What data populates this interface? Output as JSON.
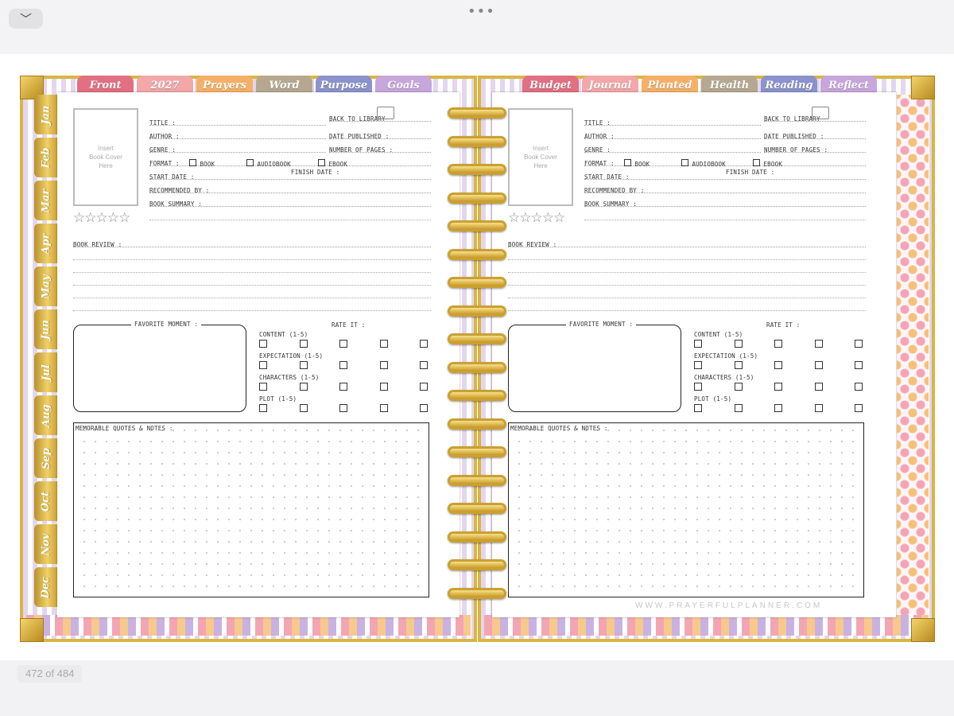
{
  "viewer": {
    "collapse_icon": "chevron-down-icon",
    "more_icon": "ellipsis-icon",
    "more_label": "•••",
    "collapse_label": "﹀",
    "page_indicator": "472 of 484"
  },
  "colors": {
    "tab_front": "#e26f82",
    "tab_2027": "#f2a7a8",
    "tab_prayers": "#f5b068",
    "tab_word": "#b6a890",
    "tab_purpose": "#8b93cc",
    "tab_goals": "#c7a6dc",
    "tab_budget": "#e26f82",
    "tab_journal": "#f2a7a8",
    "tab_planted": "#f5b068",
    "tab_health": "#b6a890",
    "tab_reading": "#8b93cc",
    "tab_reflect": "#c7a6dc",
    "frame_gold": "#d9b544"
  },
  "left_tabs": [
    "Front",
    "2027",
    "Prayers",
    "Word",
    "Purpose",
    "Goals"
  ],
  "right_tabs": [
    "Budget",
    "Journal",
    "Planted",
    "Health",
    "Reading",
    "Reflect"
  ],
  "month_tabs": [
    "Jan",
    "Feb",
    "Mar",
    "Apr",
    "May",
    "Jun",
    "Jul",
    "Aug",
    "Sep",
    "Oct",
    "Nov",
    "Dec"
  ],
  "book_page": {
    "cover_placeholder": [
      "Insert",
      "Book Cover",
      "Here"
    ],
    "back_to_library": "BACK TO LIBRARY",
    "title": "TITLE :",
    "author": "AUTHOR :",
    "genre": "GENRE :",
    "format": "FORMAT :",
    "format_options": [
      "BOOK",
      "AUDIOBOOK",
      "EBOOK"
    ],
    "start_date": "START DATE :",
    "finish_date": "FINISH DATE :",
    "recommended_by": "RECOMMENDED BY :",
    "book_summary": "BOOK SUMMARY :",
    "date_published": "DATE PUBLISHED :",
    "number_of_pages": "NUMBER OF PAGES :",
    "stars": "☆☆☆☆☆",
    "book_review": "BOOK REVIEW :",
    "favorite_moment": "FAVORITE MOMENT :",
    "rate_it": "RATE IT :",
    "ratings": [
      "CONTENT (1-5)",
      "EXPECTATION (1-5)",
      "CHARACTERS (1-5)",
      "PLOT (1-5)"
    ],
    "memorable": "MEMORABLE QUOTES & NOTES :",
    "watermark": "WWW.PRAYERFULPLANNER.COM"
  }
}
